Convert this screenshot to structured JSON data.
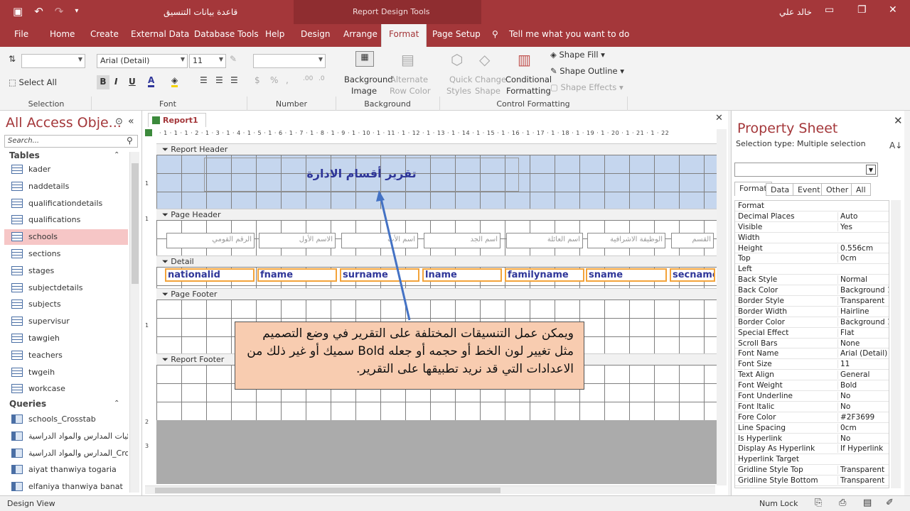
{
  "app": {
    "db_title": "قاعدة بيانات التنسيق",
    "context_title": "Report Design Tools",
    "user": "خالد علي"
  },
  "tabs": [
    "File",
    "Home",
    "Create",
    "External Data",
    "Database Tools",
    "Help",
    "Design",
    "Arrange",
    "Format",
    "Page Setup"
  ],
  "active_tab": "Format",
  "tell_me": "Tell me what you want to do",
  "ribbon": {
    "selection": {
      "label": "Selection",
      "select_all": "Select All"
    },
    "font": {
      "label": "Font",
      "family": "Arial (Detail)",
      "size": "11"
    },
    "number": {
      "label": "Number"
    },
    "background": {
      "label": "Background",
      "bg_image": "Background",
      "bg_image2": "Image",
      "alt_row": "Alternate",
      "alt_row2": "Row Color"
    },
    "control_formatting": {
      "label": "Control Formatting",
      "quick1": "Quick",
      "quick2": "Styles",
      "change1": "Change",
      "change2": "Shape",
      "cond1": "Conditional",
      "cond2": "Formatting",
      "shape_fill": "Shape Fill",
      "shape_outline": "Shape Outline",
      "shape_effects": "Shape Effects"
    }
  },
  "nav": {
    "title": "All Access Obje...",
    "search_placeholder": "Search...",
    "tables_label": "Tables",
    "tables": [
      "kader",
      "naddetails",
      "qualificationdetails",
      "qualifications",
      "schools",
      "sections",
      "stages",
      "subjectdetails",
      "subjects",
      "supervisur",
      "tawgieh",
      "teachers",
      "twgeih",
      "workcase"
    ],
    "selected_table": "schools",
    "queries_label": "Queries",
    "queries": [
      "schools_Crosstab",
      "احصائيات المدارس والمواد الدراسية",
      "المدارس والمواد الدراسية_Crosst...",
      "aiyat thanwiya togaria",
      "elfaniya thanwiya banat"
    ]
  },
  "document": {
    "tab": "Report1",
    "ruler": "· 1 · 1 · 1 · 2 · 1 · 3 · 1 · 4 · 1 · 5 · 1 · 6 · 1 · 7 · 1 · 8 · 1 · 9 · 1 · 10 · 1 · 11 · 1 · 12 · 1 · 13 · 1 · 14 · 1 · 15 · 1 · 16 · 1 · 17 · 1 · 18 · 1 · 19 · 1 · 20 · 1 · 21 · 1 · 22",
    "sections": {
      "report_header": "Report Header",
      "page_header": "Page Header",
      "detail": "Detail",
      "page_footer": "Page Footer",
      "report_footer": "Report Footer"
    },
    "report_title": "تقرير أقسام الادارة",
    "header_labels": [
      "الرقم القومي",
      "الاسم الأول",
      "اسم الأب",
      "اسم الجد",
      "اسم العائلة",
      "الوظيفة الاشرافية",
      "القسم"
    ],
    "detail_fields": [
      "nationalid",
      "fname",
      "surname",
      "lname",
      "familyname",
      "sname",
      "secname"
    ],
    "callout": "ويمكن عمل التنسيقات المختلفة على التقرير في وضع التصميم مثل تغيير لون الخط أو حجمه أو جعله Bold سميك أو غير ذلك من الاعدادات التي قد نريد تطبيقها على التقرير."
  },
  "property_sheet": {
    "title": "Property Sheet",
    "selection_type": "Selection type:  Multiple selection",
    "tabs": [
      "Format",
      "Data",
      "Event",
      "Other",
      "All"
    ],
    "active_tab": "Format",
    "rows": [
      [
        "Format",
        ""
      ],
      [
        "Decimal Places",
        "Auto"
      ],
      [
        "Visible",
        "Yes"
      ],
      [
        "Width",
        ""
      ],
      [
        "Height",
        "0.556cm"
      ],
      [
        "Top",
        "0cm"
      ],
      [
        "Left",
        ""
      ],
      [
        "Back Style",
        "Normal"
      ],
      [
        "Back Color",
        "Background 1"
      ],
      [
        "Border Style",
        "Transparent"
      ],
      [
        "Border Width",
        "Hairline"
      ],
      [
        "Border Color",
        "Background 1"
      ],
      [
        "Special Effect",
        "Flat"
      ],
      [
        "Scroll Bars",
        "None"
      ],
      [
        "Font Name",
        "Arial (Detail)"
      ],
      [
        "Font Size",
        "11"
      ],
      [
        "Text Align",
        "General"
      ],
      [
        "Font Weight",
        "Bold"
      ],
      [
        "Font Underline",
        "No"
      ],
      [
        "Font Italic",
        "No"
      ],
      [
        "Fore Color",
        "#2F3699"
      ],
      [
        "Line Spacing",
        "0cm"
      ],
      [
        "Is Hyperlink",
        "No"
      ],
      [
        "Display As Hyperlink",
        "If Hyperlink"
      ],
      [
        "Hyperlink Target",
        ""
      ],
      [
        "Gridline Style Top",
        "Transparent"
      ],
      [
        "Gridline Style Bottom",
        "Transparent"
      ]
    ]
  },
  "status": {
    "left": "Design View",
    "numlock": "Num Lock"
  },
  "colors": {
    "accent": "#a4373a",
    "field_text": "#2f3699",
    "callout_bg": "#f8ccb0",
    "selection": "#f6c6c6"
  }
}
